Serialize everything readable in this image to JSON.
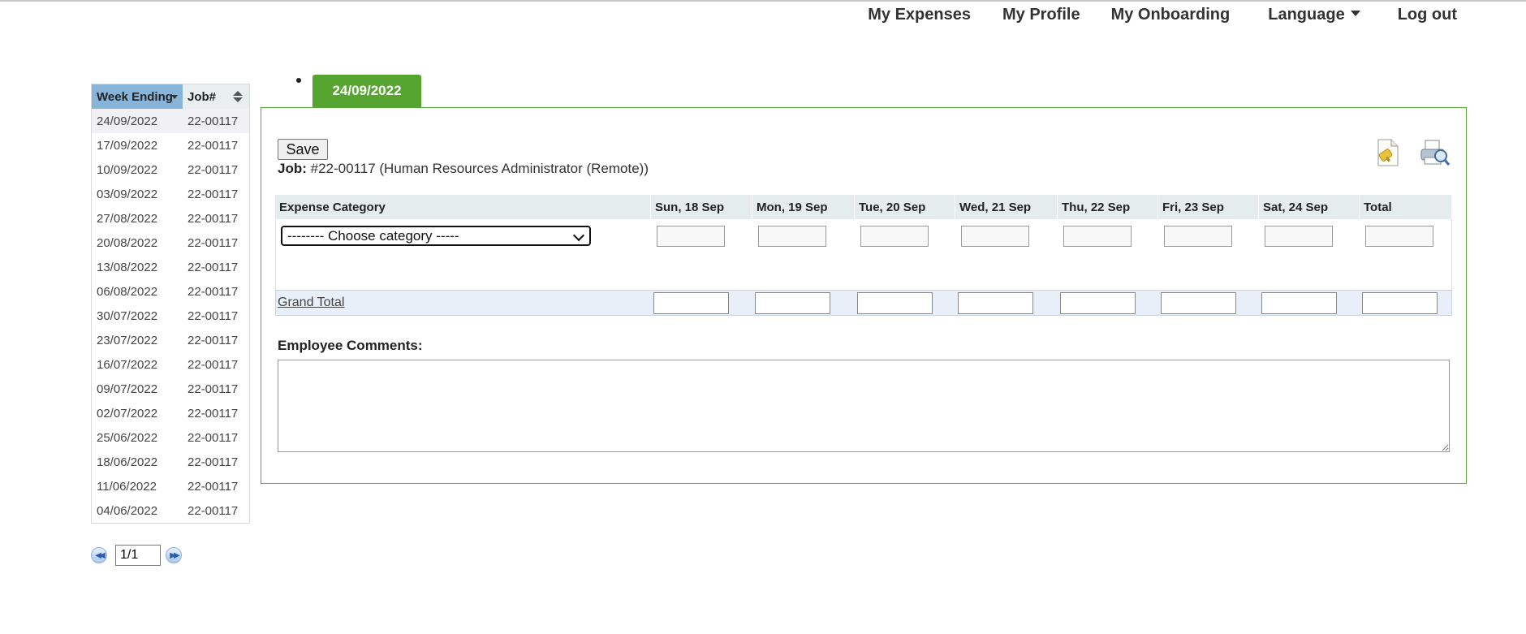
{
  "nav": {
    "items": [
      "My Expenses",
      "My Profile",
      "My Onboarding",
      "Language",
      "Log out"
    ]
  },
  "week_list": {
    "headers": [
      "Week Ending",
      "Job#"
    ],
    "rows": [
      {
        "week": "24/09/2022",
        "job": "22-00117"
      },
      {
        "week": "17/09/2022",
        "job": "22-00117"
      },
      {
        "week": "10/09/2022",
        "job": "22-00117"
      },
      {
        "week": "03/09/2022",
        "job": "22-00117"
      },
      {
        "week": "27/08/2022",
        "job": "22-00117"
      },
      {
        "week": "20/08/2022",
        "job": "22-00117"
      },
      {
        "week": "13/08/2022",
        "job": "22-00117"
      },
      {
        "week": "06/08/2022",
        "job": "22-00117"
      },
      {
        "week": "30/07/2022",
        "job": "22-00117"
      },
      {
        "week": "23/07/2022",
        "job": "22-00117"
      },
      {
        "week": "16/07/2022",
        "job": "22-00117"
      },
      {
        "week": "09/07/2022",
        "job": "22-00117"
      },
      {
        "week": "02/07/2022",
        "job": "22-00117"
      },
      {
        "week": "25/06/2022",
        "job": "22-00117"
      },
      {
        "week": "18/06/2022",
        "job": "22-00117"
      },
      {
        "week": "11/06/2022",
        "job": "22-00117"
      },
      {
        "week": "04/06/2022",
        "job": "22-00117"
      }
    ],
    "pager_value": "1/1"
  },
  "tab": {
    "label": "24/09/2022"
  },
  "form": {
    "save_label": "Save",
    "job_label": "Job:",
    "job_value": "#22-00117 (Human Resources Administrator (Remote))",
    "columns": [
      "Expense Category",
      "Sun, 18 Sep",
      "Mon, 19 Sep",
      "Tue, 20 Sep",
      "Wed, 21 Sep",
      "Thu, 22 Sep",
      "Fri, 23 Sep",
      "Sat, 24 Sep",
      "Total"
    ],
    "category_placeholder": "-------- Choose category -----",
    "grand_total_label": "Grand Total",
    "comments_label": "Employee Comments:",
    "comments_value": ""
  },
  "colors": {
    "accent_green": "#56a531",
    "header_blue": "#86b5d9"
  },
  "icons": [
    "expense-note-icon",
    "print-preview-icon",
    "first-page-icon",
    "last-page-icon"
  ]
}
